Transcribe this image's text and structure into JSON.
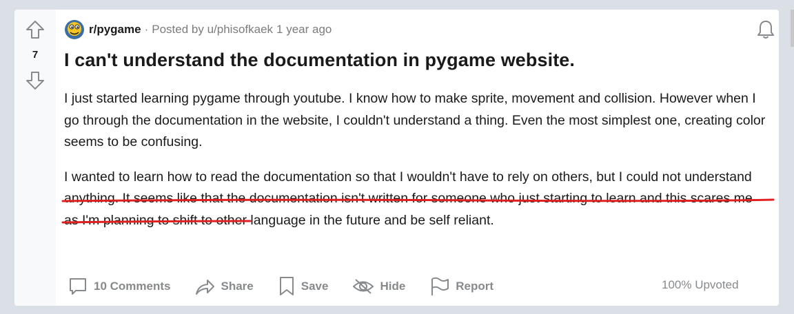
{
  "post": {
    "score": "7",
    "subreddit": "r/pygame",
    "posted_by": "Posted by u/phisofkaek",
    "age": "1 year ago",
    "title": "I can't understand the documentation in pygame website.",
    "paragraphs": [
      "I just started learning pygame through youtube. I know how to make sprite, movement and collision. However when I go through the documentation in the website, I couldn't understand a thing. Even the most simplest one, creating color seems to be confusing.",
      "I wanted to learn how to read the documentation so that I wouldn't have to rely on others, but I could not understand anything. It seems like that the documentation isn't written for someone who just starting to learn and this scares me as I'm planning to shift to other language in the future and be self reliant."
    ],
    "upvoted": "100% Upvoted"
  },
  "actions": {
    "comments": "10 Comments",
    "share": "Share",
    "save": "Save",
    "hide": "Hide",
    "report": "Report"
  },
  "icons": {
    "upvote": "upvote-arrow-icon",
    "downvote": "downvote-arrow-icon",
    "subreddit": "pygame-snake-icon",
    "notifications": "bell-icon",
    "comments": "comment-bubble-icon",
    "share": "share-arrow-icon",
    "save": "bookmark-icon",
    "hide": "eye-slash-icon",
    "report": "flag-icon"
  },
  "colors": {
    "annotation": "#e02020",
    "text": "#1a1a1b",
    "muted": "#878a8c",
    "background": "#dae0e6"
  }
}
